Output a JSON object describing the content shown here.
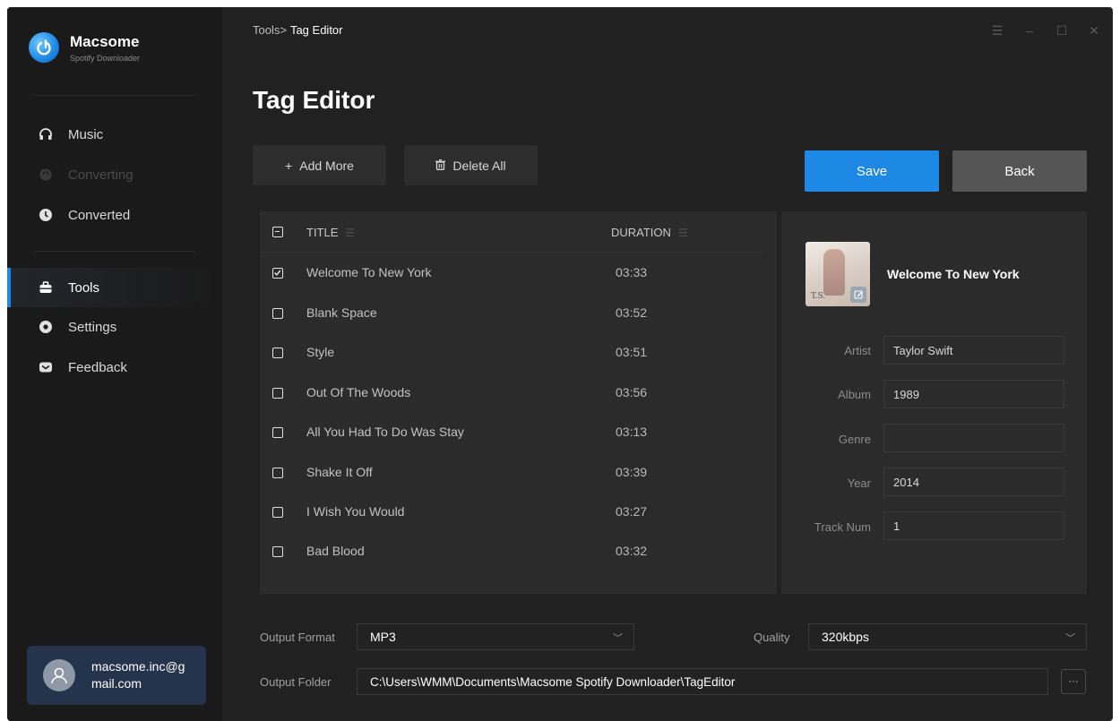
{
  "brand": {
    "name": "Macsome",
    "subtitle": "Spotify Downloader"
  },
  "sidebar": {
    "items": [
      {
        "label": "Music",
        "icon": "headphones-icon",
        "state": "normal"
      },
      {
        "label": "Converting",
        "icon": "converting-icon",
        "state": "disabled"
      },
      {
        "label": "Converted",
        "icon": "clock-icon",
        "state": "normal"
      },
      {
        "label": "Tools",
        "icon": "toolbox-icon",
        "state": "active"
      },
      {
        "label": "Settings",
        "icon": "gear-icon",
        "state": "normal"
      },
      {
        "label": "Feedback",
        "icon": "mail-icon",
        "state": "normal"
      }
    ],
    "user": {
      "email": "macsome.inc@gmail.com"
    }
  },
  "breadcrumb": {
    "parent": "Tools",
    "separator": ">",
    "current": "Tag Editor"
  },
  "page": {
    "title": "Tag Editor"
  },
  "toolbar": {
    "add_more": "Add More",
    "delete_all": "Delete All",
    "save": "Save",
    "back": "Back"
  },
  "table": {
    "headers": {
      "title": "TITLE",
      "duration": "DURATION"
    },
    "rows": [
      {
        "title": "Welcome To New York",
        "duration": "03:33",
        "checked": true
      },
      {
        "title": "Blank Space",
        "duration": "03:52",
        "checked": false
      },
      {
        "title": "Style",
        "duration": "03:51",
        "checked": false
      },
      {
        "title": "Out Of The Woods",
        "duration": "03:56",
        "checked": false
      },
      {
        "title": "All You Had To Do Was Stay",
        "duration": "03:13",
        "checked": false
      },
      {
        "title": "Shake It Off",
        "duration": "03:39",
        "checked": false
      },
      {
        "title": "I Wish You Would",
        "duration": "03:27",
        "checked": false
      },
      {
        "title": "Bad Blood",
        "duration": "03:32",
        "checked": false
      }
    ]
  },
  "detail": {
    "track_title": "Welcome To New York",
    "cover_text": "T.S.",
    "fields": [
      {
        "label": "Artist",
        "value": "Taylor Swift"
      },
      {
        "label": "Album",
        "value": "1989"
      },
      {
        "label": "Genre",
        "value": ""
      },
      {
        "label": "Year",
        "value": "2014"
      },
      {
        "label": "Track Num",
        "value": "1"
      }
    ]
  },
  "output": {
    "format_label": "Output Format",
    "format_value": "MP3",
    "quality_label": "Quality",
    "quality_value": "320kbps",
    "folder_label": "Output Folder",
    "folder_value": "C:\\Users\\WMM\\Documents\\Macsome Spotify Downloader\\TagEditor",
    "browse_label": "···"
  },
  "colors": {
    "accent": "#1e88e5",
    "background": "#212121",
    "sidebar": "#1a1a1a",
    "panel": "#2b2b2b",
    "back_button": "#555555"
  }
}
